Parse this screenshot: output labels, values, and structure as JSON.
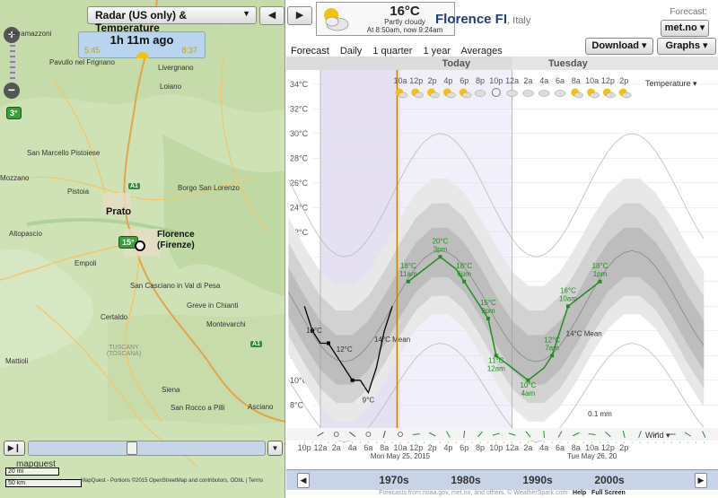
{
  "map": {
    "radar_select": "Radar (US only) & Temperature",
    "prev_label": "◀",
    "next_label": "▶",
    "time_ago": "1h 11m ago",
    "sunrise_time": "5:45",
    "sunset_time": "8:37",
    "zoom_in": "+",
    "zoom_out": "−",
    "temp_small": "3°",
    "temp_city": "15°",
    "towns": [
      "Serramazzoni",
      "Pavullo nel Frignano",
      "Loiano",
      "Livergnano",
      "San Marcello Pistoiese",
      "Borgo San Lorenzo",
      "Mozzano",
      "Pistoia",
      "Prato",
      "Altopascio",
      "Empoli",
      "San Casciano in Val di Pesa",
      "Greve in Chianti",
      "Certaldo",
      "Montevarchi",
      "TUSCANY (TOSCANA)",
      "Mattioli",
      "Siena",
      "San Rocco a Pilli",
      "Asciano"
    ],
    "city": "Florence",
    "city_local": "(Firenze)",
    "road_a1": "A1",
    "mapquest": "mapquest",
    "attribution": "MapQuest - Portions ©2015 OpenStreetMap and contributors, ODbL | Terms",
    "scale_mi": "20 mi",
    "scale_km": "50 km"
  },
  "weather": {
    "current_temp": "16°C",
    "current_desc": "Partly cloudy",
    "current_time": "At 8:50am, now 9:24am",
    "place": "Florence FI",
    "country": ", Italy",
    "forecast_label": "Forecast:",
    "forecast_source": "met.no ▾",
    "download": "Download ▾",
    "graphs": "Graphs ▾",
    "tabs": [
      "Forecast",
      "Daily",
      "1 quarter",
      "1 year",
      "Averages"
    ],
    "day_today": "Today",
    "day_next": "Tuesday",
    "temperature_label": "Temperature ▾",
    "wind_label": "Wind ▾",
    "precip_label": "0.1 mm",
    "date_left": "Mon May 25, 2015",
    "date_right": "Tue May 26, 20",
    "decades": [
      "1970s",
      "1980s",
      "1990s",
      "2000s"
    ],
    "decade_prev": "◀",
    "decade_next": "▶",
    "footer_text": "Forecasts from noaa.gov,",
    "footer_met": "met.no",
    "footer_rest": ", and others. © WeatherSpark.com",
    "footer_help": "Help",
    "footer_full": "Full Screen"
  },
  "chart_data": {
    "type": "line",
    "ylabel": "°C",
    "ylim": [
      7,
      35
    ],
    "y_ticks": [
      "8°C",
      "10°C",
      "12°C",
      "14°C",
      "16°C",
      "18°C",
      "20°C",
      "22°C",
      "24°C",
      "26°C",
      "28°C",
      "30°C",
      "32°C",
      "34°C"
    ],
    "x_ticks_top": [
      "10a",
      "12p",
      "2p",
      "4p",
      "6p",
      "8p",
      "10p",
      "12a",
      "2a",
      "4a",
      "6a",
      "8a",
      "10a",
      "12p",
      "2p"
    ],
    "x_ticks_bottom": [
      "10p",
      "12a",
      "2a",
      "4a",
      "6a",
      "8a",
      "10a",
      "12p",
      "2p",
      "4p",
      "6p",
      "8p",
      "10p",
      "12a",
      "2a",
      "4a",
      "6a",
      "8a",
      "10a",
      "12p",
      "2p"
    ],
    "mean_label_1": "14°C Mean",
    "mean_label_2": "14°C Mean",
    "observed_labels": [
      {
        "text": "14°C",
        "sub": ""
      },
      {
        "text": "12°C",
        "sub": ""
      },
      {
        "text": "9°C",
        "sub": ""
      }
    ],
    "series": [
      {
        "name": "Observed",
        "color": "#000000",
        "x_hours": [
          -2,
          -1,
          0,
          1,
          2,
          3,
          4,
          5,
          6,
          7,
          8,
          9
        ],
        "values": [
          16,
          14,
          13,
          13,
          12,
          11,
          10,
          10,
          9,
          11,
          14,
          16
        ]
      },
      {
        "name": "Forecast",
        "color": "#1f8f1f",
        "x_hours": [
          11,
          13,
          15,
          17,
          18,
          19,
          21,
          22,
          24,
          26,
          28,
          29,
          31,
          33,
          35
        ],
        "values": [
          18,
          19,
          20,
          19,
          18,
          17,
          15,
          12,
          11,
          10,
          11,
          12,
          16,
          17,
          18
        ]
      }
    ],
    "forecast_labels": [
      {
        "temp": "18°C",
        "time": "11am"
      },
      {
        "temp": "20°C",
        "time": "3pm"
      },
      {
        "temp": "18°C",
        "time": "6pm"
      },
      {
        "temp": "15°C",
        "time": "9pm"
      },
      {
        "temp": "11°C",
        "time": "12am"
      },
      {
        "temp": "10°C",
        "time": "4am"
      },
      {
        "temp": "12°C",
        "time": "7am"
      },
      {
        "temp": "16°C",
        "time": "10am"
      },
      {
        "temp": "18°C",
        "time": "1pm"
      }
    ],
    "band_colors": [
      "#e8e8e8",
      "#d2d2d2",
      "#bdbdbd"
    ],
    "night_shade": "#e5e1f3"
  }
}
